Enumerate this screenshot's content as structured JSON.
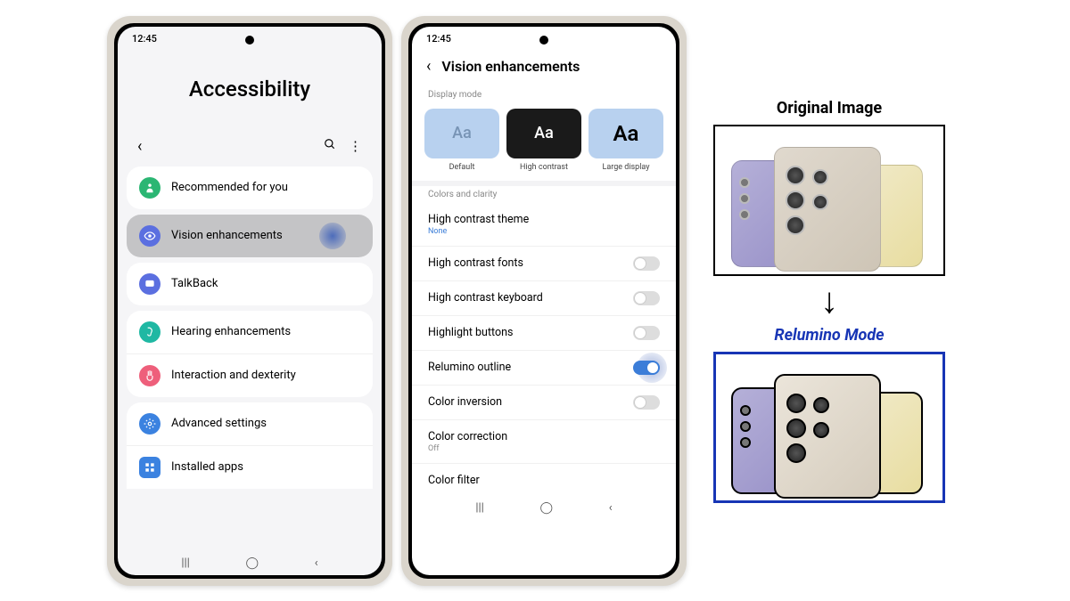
{
  "status_time": "12:45",
  "phone1": {
    "title": "Accessibility",
    "items": [
      {
        "label": "Recommended for you",
        "icon_color": "#2bb673"
      },
      {
        "label": "Vision enhancements",
        "icon_color": "#5b6fe0"
      },
      {
        "label": "TalkBack",
        "icon_color": "#5b6fe0"
      },
      {
        "label": "Hearing enhancements",
        "icon_color": "#1fb8a3"
      },
      {
        "label": "Interaction and dexterity",
        "icon_color": "#ee5f7b"
      },
      {
        "label": "Advanced settings",
        "icon_color": "#3b82e0"
      },
      {
        "label": "Installed apps",
        "icon_color": "#3b82e0"
      }
    ]
  },
  "phone2": {
    "title": "Vision enhancements",
    "section_display": "Display mode",
    "modes": [
      {
        "label": "Default",
        "sample": "Aa"
      },
      {
        "label": "High contrast",
        "sample": "Aa"
      },
      {
        "label": "Large display",
        "sample": "Aa"
      }
    ],
    "section_colors": "Colors and clarity",
    "rows": [
      {
        "label": "High contrast theme",
        "sub": "None",
        "toggle": null
      },
      {
        "label": "High contrast fonts",
        "toggle": false
      },
      {
        "label": "High contrast keyboard",
        "toggle": false
      },
      {
        "label": "Highlight buttons",
        "toggle": false
      },
      {
        "label": "Relumino outline",
        "toggle": true
      },
      {
        "label": "Color inversion",
        "toggle": false
      },
      {
        "label": "Color correction",
        "sub": "Off",
        "toggle": null
      },
      {
        "label": "Color filter",
        "toggle": null
      }
    ]
  },
  "comparison": {
    "title_original": "Original Image",
    "title_relumino": "Relumino Mode"
  }
}
